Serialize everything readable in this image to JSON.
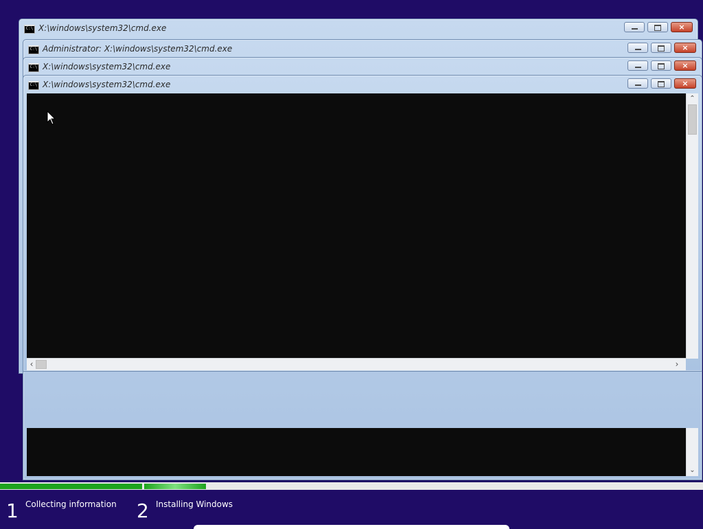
{
  "windows": [
    {
      "title": "X:\\windows\\system32\\cmd.exe",
      "icon": "cmd-icon",
      "icon_text": "C:\\"
    },
    {
      "title": "Administrator: X:\\windows\\system32\\cmd.exe",
      "icon": "cmd-icon",
      "icon_text": "C:\\"
    },
    {
      "title": "X:\\windows\\system32\\cmd.exe",
      "icon": "cmd-icon",
      "icon_text": "C:\\"
    },
    {
      "title": "X:\\windows\\system32\\cmd.exe",
      "icon": "cmd-icon",
      "icon_text": "C:\\"
    }
  ],
  "controls": {
    "minimize": "",
    "maximize": "",
    "close": "×"
  },
  "setup": {
    "steps": [
      {
        "number": "1",
        "label": "Collecting information"
      },
      {
        "number": "2",
        "label": "Installing Windows"
      }
    ],
    "step1_progress": 1.0,
    "step2_progress": 0.11
  },
  "colors": {
    "background": "#1f0c66",
    "console": "#0c0c0c",
    "progress": "#1ea31e"
  }
}
